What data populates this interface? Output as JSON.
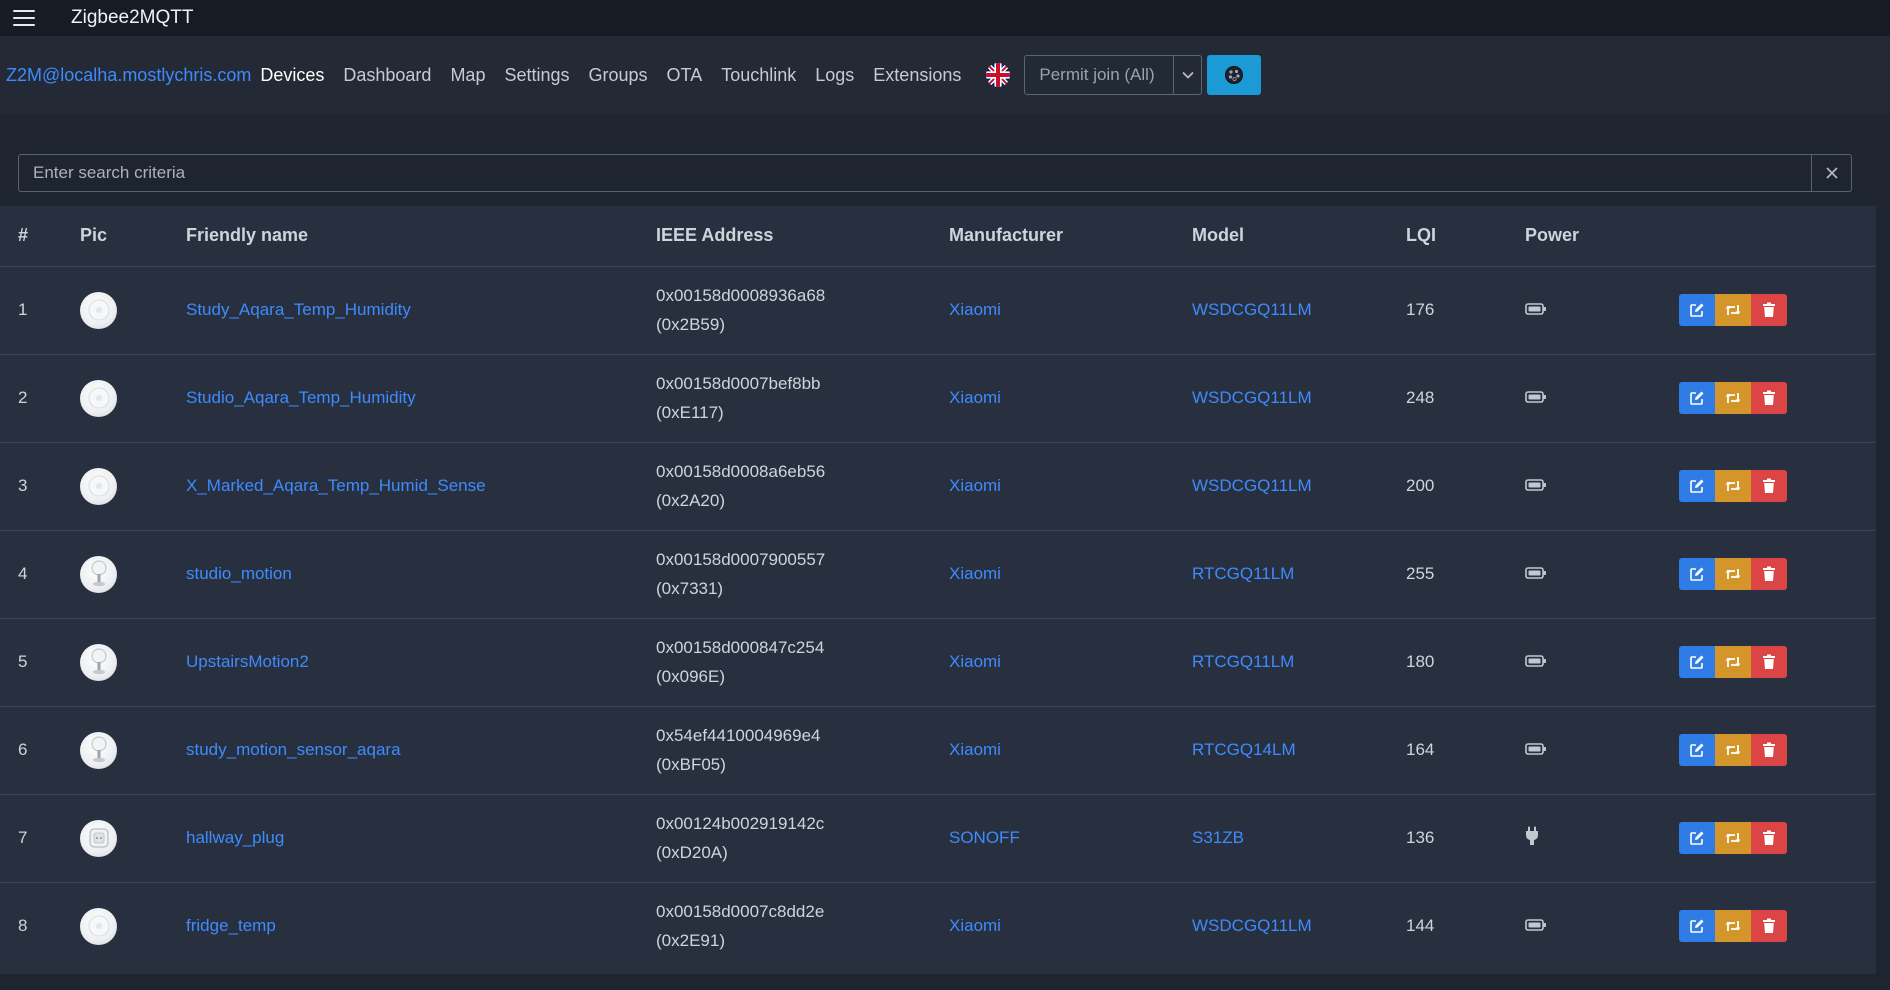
{
  "app": {
    "title": "Zigbee2MQTT"
  },
  "nav": {
    "brand": "Z2M@localha.mostlychris.com",
    "links": [
      "Devices",
      "Dashboard",
      "Map",
      "Settings",
      "Groups",
      "OTA",
      "Touchlink",
      "Logs",
      "Extensions"
    ],
    "active": "Devices",
    "permit_join_label": "Permit join (All)"
  },
  "search": {
    "placeholder": "Enter search criteria"
  },
  "table": {
    "headers": [
      "#",
      "Pic",
      "Friendly name",
      "IEEE Address",
      "Manufacturer",
      "Model",
      "LQI",
      "Power"
    ],
    "rows": [
      {
        "index": "1",
        "pic": "temp-sensor",
        "name": "Study_Aqara_Temp_Humidity",
        "ieee": "0x00158d0008936a68",
        "nwk": "(0x2B59)",
        "manufacturer": "Xiaomi",
        "model": "WSDCGQ11LM",
        "lqi": "176",
        "power": "battery"
      },
      {
        "index": "2",
        "pic": "temp-sensor",
        "name": "Studio_Aqara_Temp_Humidity",
        "ieee": "0x00158d0007bef8bb",
        "nwk": "(0xE117)",
        "manufacturer": "Xiaomi",
        "model": "WSDCGQ11LM",
        "lqi": "248",
        "power": "battery"
      },
      {
        "index": "3",
        "pic": "temp-sensor",
        "name": "X_Marked_Aqara_Temp_Humid_Sense",
        "ieee": "0x00158d0008a6eb56",
        "nwk": "(0x2A20)",
        "manufacturer": "Xiaomi",
        "model": "WSDCGQ11LM",
        "lqi": "200",
        "power": "battery"
      },
      {
        "index": "4",
        "pic": "motion-sensor",
        "name": "studio_motion",
        "ieee": "0x00158d0007900557",
        "nwk": "(0x7331)",
        "manufacturer": "Xiaomi",
        "model": "RTCGQ11LM",
        "lqi": "255",
        "power": "battery"
      },
      {
        "index": "5",
        "pic": "motion-sensor",
        "name": "UpstairsMotion2",
        "ieee": "0x00158d000847c254",
        "nwk": "(0x096E)",
        "manufacturer": "Xiaomi",
        "model": "RTCGQ11LM",
        "lqi": "180",
        "power": "battery"
      },
      {
        "index": "6",
        "pic": "motion-sensor",
        "name": "study_motion_sensor_aqara",
        "ieee": "0x54ef4410004969e4",
        "nwk": "(0xBF05)",
        "manufacturer": "Xiaomi",
        "model": "RTCGQ14LM",
        "lqi": "164",
        "power": "battery"
      },
      {
        "index": "7",
        "pic": "smart-plug",
        "name": "hallway_plug",
        "ieee": "0x00124b002919142c",
        "nwk": "(0xD20A)",
        "manufacturer": "SONOFF",
        "model": "S31ZB",
        "lqi": "136",
        "power": "mains"
      },
      {
        "index": "8",
        "pic": "temp-sensor",
        "name": "fridge_temp",
        "ieee": "0x00158d0007c8dd2e",
        "nwk": "(0x2E91)",
        "manufacturer": "Xiaomi",
        "model": "WSDCGQ11LM",
        "lqi": "144",
        "power": "battery"
      }
    ]
  },
  "colors": {
    "link": "#3d8bfd",
    "edit_button": "#2f7ce6",
    "rename_button": "#d4952a",
    "remove_button": "#dc4545",
    "theme_button": "#1c9ad6"
  }
}
